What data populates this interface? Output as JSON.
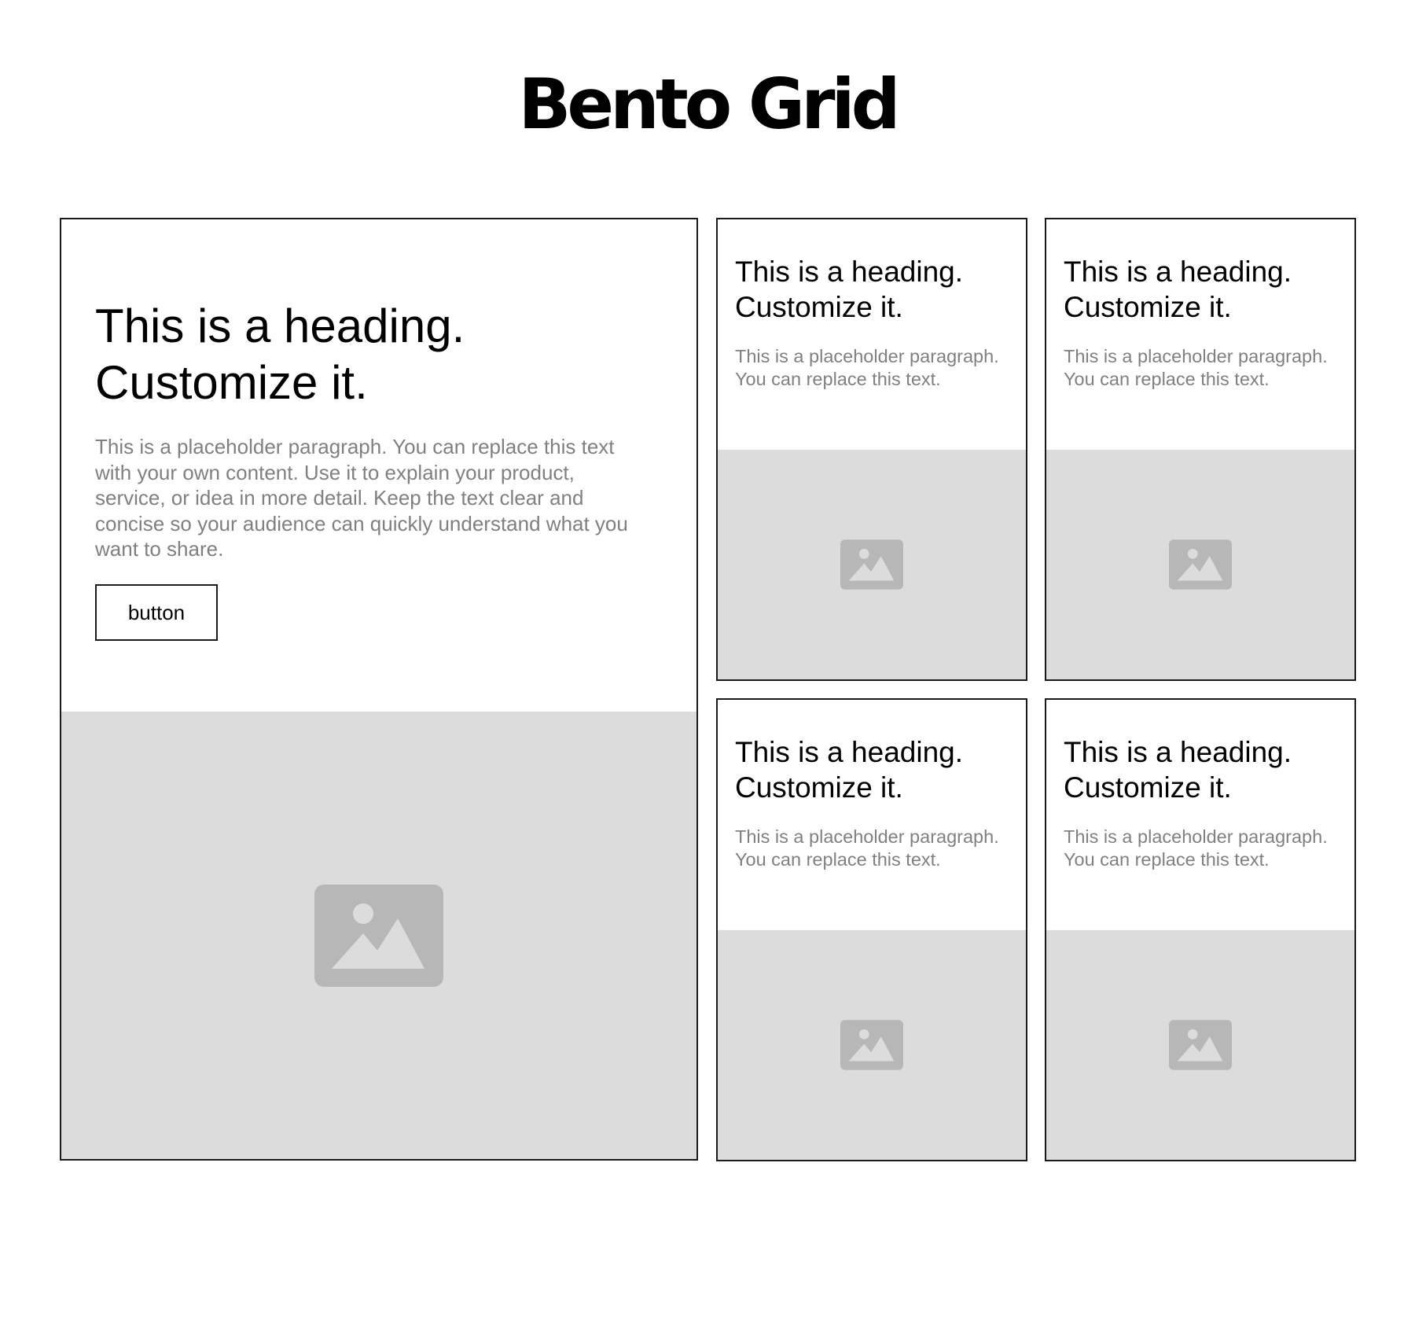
{
  "page": {
    "title": "Bento Grid"
  },
  "colors": {
    "border": "#1a1a1a",
    "placeholder_bg": "#dcdcdc",
    "placeholder_icon": "#b7b7b7",
    "paragraph": "#808080"
  },
  "feature_card": {
    "heading": "This is a heading. Customize it.",
    "paragraph": "This is a placeholder paragraph. You can replace this text with your own content. Use it to explain your product, service, or idea in more detail. Keep the text clear and concise so your audience can quickly understand what you want to share.",
    "button_label": "button",
    "image_icon": "image-icon"
  },
  "cards": [
    {
      "heading": "This is a heading. Customize it.",
      "paragraph": "This is a placeholder paragraph. You can replace this text.",
      "image_icon": "image-icon"
    },
    {
      "heading": "This is a heading. Customize it.",
      "paragraph": "This is a placeholder paragraph. You can replace this text.",
      "image_icon": "image-icon"
    },
    {
      "heading": "This is a heading. Customize it.",
      "paragraph": "This is a placeholder paragraph. You can replace this text.",
      "image_icon": "image-icon"
    },
    {
      "heading": "This is a heading. Customize it.",
      "paragraph": "This is a placeholder paragraph. You can replace this text.",
      "image_icon": "image-icon"
    }
  ]
}
